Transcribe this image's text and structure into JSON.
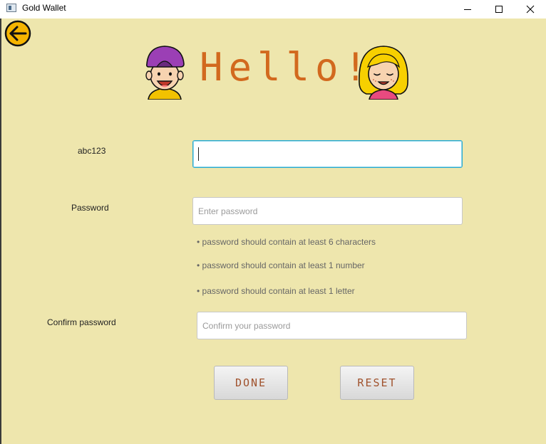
{
  "window": {
    "title": "Gold Wallet",
    "controls": {
      "minimize": "minimize",
      "maximize": "maximize",
      "close": "close"
    }
  },
  "header": {
    "greeting": "Hello!",
    "left_avatar_icon": "boy-avatar-icon",
    "right_avatar_icon": "girl-avatar-icon",
    "back_icon": "back-arrow-icon"
  },
  "form": {
    "username": {
      "label": "abc123",
      "value": "",
      "placeholder": ""
    },
    "password": {
      "label": "Password",
      "value": "",
      "placeholder": "Enter password"
    },
    "hints": [
      "• password should contain at least 6 characters",
      "• password should contain at least 1 number",
      "• password should contain at least 1 letter"
    ],
    "confirm": {
      "label": "Confirm password",
      "value": "",
      "placeholder": "Confirm your password"
    }
  },
  "buttons": {
    "done": "DONE",
    "reset": "RESET"
  },
  "colors": {
    "background": "#eee6ad",
    "greeting": "#d2691e",
    "button_text": "#a0522d",
    "focus_border": "#2aa9cf",
    "back_button": "#f5b400"
  }
}
